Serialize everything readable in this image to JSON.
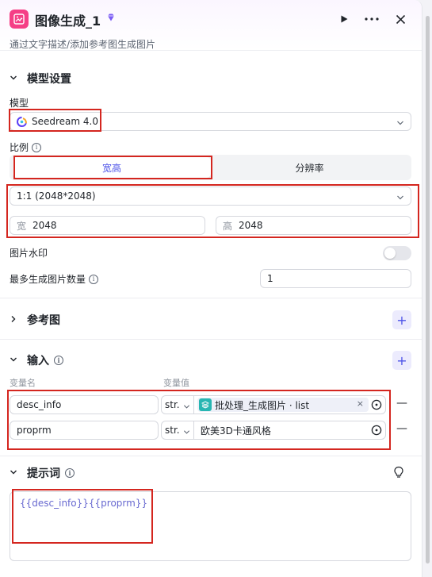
{
  "header": {
    "title": "图像生成_1",
    "subtitle": "通过文字描述/添加参考图生成图片",
    "run_icon": "play-icon",
    "more_icon": "more-horizontal-icon",
    "close_icon": "close-icon"
  },
  "model_settings": {
    "section_title": "模型设置",
    "model_label": "模型",
    "model_value": "Seedream 4.0",
    "ratio_label": "比例",
    "tabs": [
      "宽高",
      "分辨率"
    ],
    "active_tab": "宽高",
    "ratio_value": "1:1 (2048*2048)",
    "width_prefix": "宽",
    "width_value": "2048",
    "height_prefix": "高",
    "height_value": "2048",
    "watermark_label": "图片水印",
    "watermark_on": false,
    "max_count_label": "最多生成图片数量",
    "max_count_value": "1"
  },
  "reference": {
    "section_title": "参考图"
  },
  "inputs": {
    "section_title": "输入",
    "col_name": "变量名",
    "col_value": "变量值",
    "rows": [
      {
        "name": "desc_info",
        "type": "str.",
        "value": "批处理_生成图片 · list",
        "is_ref": true
      },
      {
        "name": "proprm",
        "type": "str.",
        "value": "欧美3D卡通风格",
        "is_ref": false
      }
    ]
  },
  "prompt": {
    "section_title": "提示词",
    "content": "{{desc_info}}{{proprm}}"
  },
  "colors": {
    "accent": "#4d53e8",
    "node_icon": "#f53f86",
    "annotation_red": "#d4261f",
    "ref_tag": "#27b6b2"
  }
}
